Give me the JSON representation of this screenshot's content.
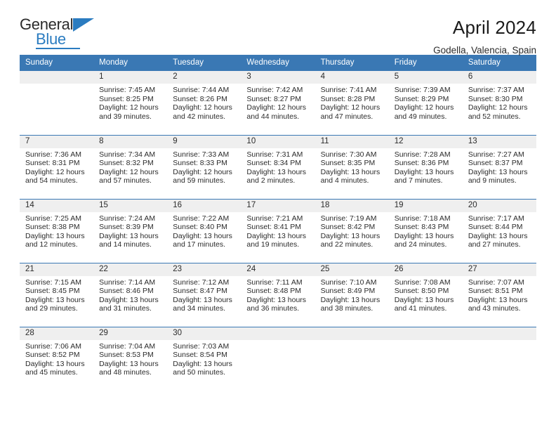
{
  "brand": {
    "name_part1": "General",
    "name_part2": "Blue",
    "triangle_icon": "brand-triangle-icon",
    "accent_color": "#2b7cc0"
  },
  "header": {
    "title": "April 2024",
    "subtitle": "Godella, Valencia, Spain"
  },
  "calendar": {
    "header_color": "#3a78b4",
    "daynum_strip_color": "#efefef",
    "weekday_headers": [
      "Sunday",
      "Monday",
      "Tuesday",
      "Wednesday",
      "Thursday",
      "Friday",
      "Saturday"
    ],
    "weeks": [
      [
        {
          "day": "",
          "lines": []
        },
        {
          "day": "1",
          "lines": [
            "Sunrise: 7:45 AM",
            "Sunset: 8:25 PM",
            "Daylight: 12 hours",
            "and 39 minutes."
          ]
        },
        {
          "day": "2",
          "lines": [
            "Sunrise: 7:44 AM",
            "Sunset: 8:26 PM",
            "Daylight: 12 hours",
            "and 42 minutes."
          ]
        },
        {
          "day": "3",
          "lines": [
            "Sunrise: 7:42 AM",
            "Sunset: 8:27 PM",
            "Daylight: 12 hours",
            "and 44 minutes."
          ]
        },
        {
          "day": "4",
          "lines": [
            "Sunrise: 7:41 AM",
            "Sunset: 8:28 PM",
            "Daylight: 12 hours",
            "and 47 minutes."
          ]
        },
        {
          "day": "5",
          "lines": [
            "Sunrise: 7:39 AM",
            "Sunset: 8:29 PM",
            "Daylight: 12 hours",
            "and 49 minutes."
          ]
        },
        {
          "day": "6",
          "lines": [
            "Sunrise: 7:37 AM",
            "Sunset: 8:30 PM",
            "Daylight: 12 hours",
            "and 52 minutes."
          ]
        }
      ],
      [
        {
          "day": "7",
          "lines": [
            "Sunrise: 7:36 AM",
            "Sunset: 8:31 PM",
            "Daylight: 12 hours",
            "and 54 minutes."
          ]
        },
        {
          "day": "8",
          "lines": [
            "Sunrise: 7:34 AM",
            "Sunset: 8:32 PM",
            "Daylight: 12 hours",
            "and 57 minutes."
          ]
        },
        {
          "day": "9",
          "lines": [
            "Sunrise: 7:33 AM",
            "Sunset: 8:33 PM",
            "Daylight: 12 hours",
            "and 59 minutes."
          ]
        },
        {
          "day": "10",
          "lines": [
            "Sunrise: 7:31 AM",
            "Sunset: 8:34 PM",
            "Daylight: 13 hours",
            "and 2 minutes."
          ]
        },
        {
          "day": "11",
          "lines": [
            "Sunrise: 7:30 AM",
            "Sunset: 8:35 PM",
            "Daylight: 13 hours",
            "and 4 minutes."
          ]
        },
        {
          "day": "12",
          "lines": [
            "Sunrise: 7:28 AM",
            "Sunset: 8:36 PM",
            "Daylight: 13 hours",
            "and 7 minutes."
          ]
        },
        {
          "day": "13",
          "lines": [
            "Sunrise: 7:27 AM",
            "Sunset: 8:37 PM",
            "Daylight: 13 hours",
            "and 9 minutes."
          ]
        }
      ],
      [
        {
          "day": "14",
          "lines": [
            "Sunrise: 7:25 AM",
            "Sunset: 8:38 PM",
            "Daylight: 13 hours",
            "and 12 minutes."
          ]
        },
        {
          "day": "15",
          "lines": [
            "Sunrise: 7:24 AM",
            "Sunset: 8:39 PM",
            "Daylight: 13 hours",
            "and 14 minutes."
          ]
        },
        {
          "day": "16",
          "lines": [
            "Sunrise: 7:22 AM",
            "Sunset: 8:40 PM",
            "Daylight: 13 hours",
            "and 17 minutes."
          ]
        },
        {
          "day": "17",
          "lines": [
            "Sunrise: 7:21 AM",
            "Sunset: 8:41 PM",
            "Daylight: 13 hours",
            "and 19 minutes."
          ]
        },
        {
          "day": "18",
          "lines": [
            "Sunrise: 7:19 AM",
            "Sunset: 8:42 PM",
            "Daylight: 13 hours",
            "and 22 minutes."
          ]
        },
        {
          "day": "19",
          "lines": [
            "Sunrise: 7:18 AM",
            "Sunset: 8:43 PM",
            "Daylight: 13 hours",
            "and 24 minutes."
          ]
        },
        {
          "day": "20",
          "lines": [
            "Sunrise: 7:17 AM",
            "Sunset: 8:44 PM",
            "Daylight: 13 hours",
            "and 27 minutes."
          ]
        }
      ],
      [
        {
          "day": "21",
          "lines": [
            "Sunrise: 7:15 AM",
            "Sunset: 8:45 PM",
            "Daylight: 13 hours",
            "and 29 minutes."
          ]
        },
        {
          "day": "22",
          "lines": [
            "Sunrise: 7:14 AM",
            "Sunset: 8:46 PM",
            "Daylight: 13 hours",
            "and 31 minutes."
          ]
        },
        {
          "day": "23",
          "lines": [
            "Sunrise: 7:12 AM",
            "Sunset: 8:47 PM",
            "Daylight: 13 hours",
            "and 34 minutes."
          ]
        },
        {
          "day": "24",
          "lines": [
            "Sunrise: 7:11 AM",
            "Sunset: 8:48 PM",
            "Daylight: 13 hours",
            "and 36 minutes."
          ]
        },
        {
          "day": "25",
          "lines": [
            "Sunrise: 7:10 AM",
            "Sunset: 8:49 PM",
            "Daylight: 13 hours",
            "and 38 minutes."
          ]
        },
        {
          "day": "26",
          "lines": [
            "Sunrise: 7:08 AM",
            "Sunset: 8:50 PM",
            "Daylight: 13 hours",
            "and 41 minutes."
          ]
        },
        {
          "day": "27",
          "lines": [
            "Sunrise: 7:07 AM",
            "Sunset: 8:51 PM",
            "Daylight: 13 hours",
            "and 43 minutes."
          ]
        }
      ],
      [
        {
          "day": "28",
          "lines": [
            "Sunrise: 7:06 AM",
            "Sunset: 8:52 PM",
            "Daylight: 13 hours",
            "and 45 minutes."
          ]
        },
        {
          "day": "29",
          "lines": [
            "Sunrise: 7:04 AM",
            "Sunset: 8:53 PM",
            "Daylight: 13 hours",
            "and 48 minutes."
          ]
        },
        {
          "day": "30",
          "lines": [
            "Sunrise: 7:03 AM",
            "Sunset: 8:54 PM",
            "Daylight: 13 hours",
            "and 50 minutes."
          ]
        },
        {
          "day": "",
          "lines": []
        },
        {
          "day": "",
          "lines": []
        },
        {
          "day": "",
          "lines": []
        },
        {
          "day": "",
          "lines": []
        }
      ]
    ]
  }
}
